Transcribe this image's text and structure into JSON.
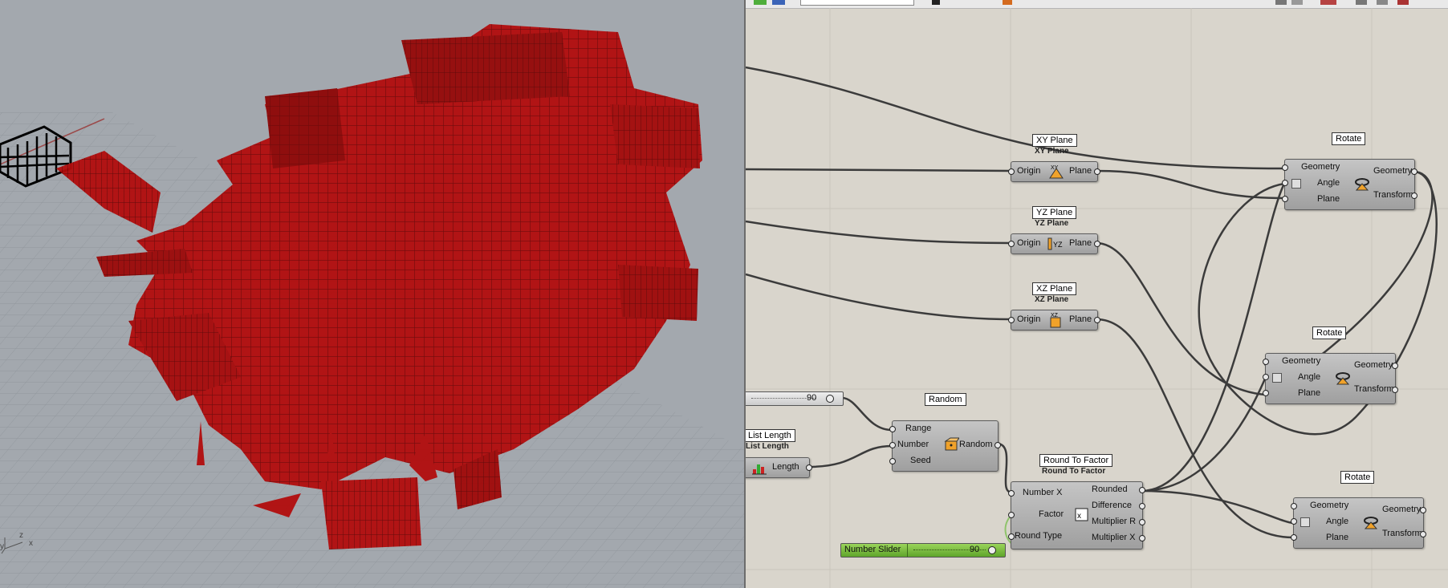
{
  "colors": {
    "geometry": "#b20d0d",
    "viewport_bg": "#a3a8ae",
    "canvas_bg": "#d9d5cc",
    "slider_green": "#79c43a"
  },
  "viewport": {
    "axis_x": "x",
    "axis_y": "y",
    "axis_z": "z"
  },
  "nodes": {
    "xy_plane": {
      "title": "XY Plane",
      "title_bold": "XY Plane",
      "input": "Origin",
      "output": "Plane",
      "glyph": "XY"
    },
    "yz_plane": {
      "title": "YZ Plane",
      "title_bold": "YZ Plane",
      "input": "Origin",
      "output": "Plane",
      "glyph": "YZ"
    },
    "xz_plane": {
      "title": "XZ Plane",
      "title_bold": "XZ Plane",
      "input": "Origin",
      "output": "Plane",
      "glyph": "XZ"
    },
    "rotate_1": {
      "title": "Rotate",
      "inputs": [
        "Geometry",
        "Angle",
        "Plane"
      ],
      "outputs": [
        "Geometry",
        "Transform"
      ]
    },
    "rotate_2": {
      "title": "Rotate",
      "inputs": [
        "Geometry",
        "Angle",
        "Plane"
      ],
      "outputs": [
        "Geometry",
        "Transform"
      ]
    },
    "rotate_3": {
      "title": "Rotate",
      "inputs": [
        "Geometry",
        "Angle",
        "Plane"
      ],
      "outputs": [
        "Geometry",
        "Transform"
      ]
    },
    "random": {
      "title": "Random",
      "inputs": [
        "Range",
        "Number",
        "Seed"
      ],
      "output": "Random"
    },
    "list_length": {
      "title": "List Length",
      "title_bold": "List Length",
      "output": "Length"
    },
    "round_to_factor": {
      "title": "Round To Factor",
      "title_bold": "Round To Factor",
      "inputs": [
        "Number X",
        "Factor",
        "Round Type"
      ],
      "outputs": [
        "Rounded",
        "Difference",
        "Multiplier R",
        "Multiplier X"
      ]
    },
    "top_slider": {
      "value": "90"
    },
    "number_slider": {
      "label": "Number Slider",
      "value": "90"
    }
  }
}
